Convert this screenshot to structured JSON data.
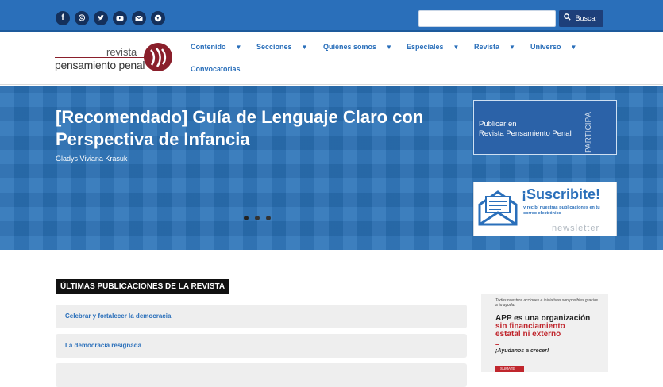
{
  "topbar": {
    "social_icons": [
      {
        "name": "facebook-icon",
        "glyph": "f"
      },
      {
        "name": "instagram-icon",
        "glyph": "◎"
      },
      {
        "name": "twitter-icon",
        "glyph": "🐦"
      },
      {
        "name": "youtube-icon",
        "glyph": "▶"
      },
      {
        "name": "mail-icon",
        "glyph": "✉"
      },
      {
        "name": "web-icon",
        "glyph": "◍"
      }
    ],
    "search": {
      "placeholder": "",
      "value": "",
      "button_label": "Buscar",
      "button_icon": "search-icon"
    }
  },
  "header": {
    "logo": {
      "line1": "revista",
      "line2": "pensamiento penal"
    },
    "nav": [
      {
        "label": "Contenido",
        "has_menu": true
      },
      {
        "label": "Secciones",
        "has_menu": true
      },
      {
        "label": "Quiénes somos",
        "has_menu": true
      },
      {
        "label": "Especiales",
        "has_menu": true
      },
      {
        "label": "Revista",
        "has_menu": true
      },
      {
        "label": "Universo",
        "has_menu": true
      },
      {
        "label": "Convocatorias",
        "has_menu": false
      }
    ]
  },
  "hero": {
    "title": "[Recomendado] Guía de Lenguaje Claro con Perspectiva de Infancia",
    "author": "Gladys Viviana Krasuk",
    "slides_total": 3,
    "active_slide": 1,
    "publish": {
      "line1": "Publicar en",
      "line2": "Revista Pensamiento Penal",
      "side": "PARTICIPÁ"
    },
    "subscribe": {
      "title": "¡Suscribite!",
      "subtitle": "y recibí nuestras publicaciones en tu correo electrónico",
      "footer": "newsletter"
    }
  },
  "main": {
    "section_title": "ÚLTIMAS PUBLICACIONES DE LA REVISTA",
    "publications": [
      "Celebrar y fortalecer la democracia",
      "La democracia resignada"
    ]
  },
  "ad": {
    "top": "Todos nuestros acciones e iniciativas son posibles gracias a tu ayuda.",
    "title": "APP es una organización",
    "red": "sin financiamiento estatal ni externo",
    "dash": "–",
    "help": "¡Ayudanos a crecer!",
    "button": "SUMATE"
  },
  "colors": {
    "primary": "#2a6fba",
    "dark": "#1d3f7a",
    "brand": "#8a1f2b",
    "alert": "#c0262d"
  }
}
